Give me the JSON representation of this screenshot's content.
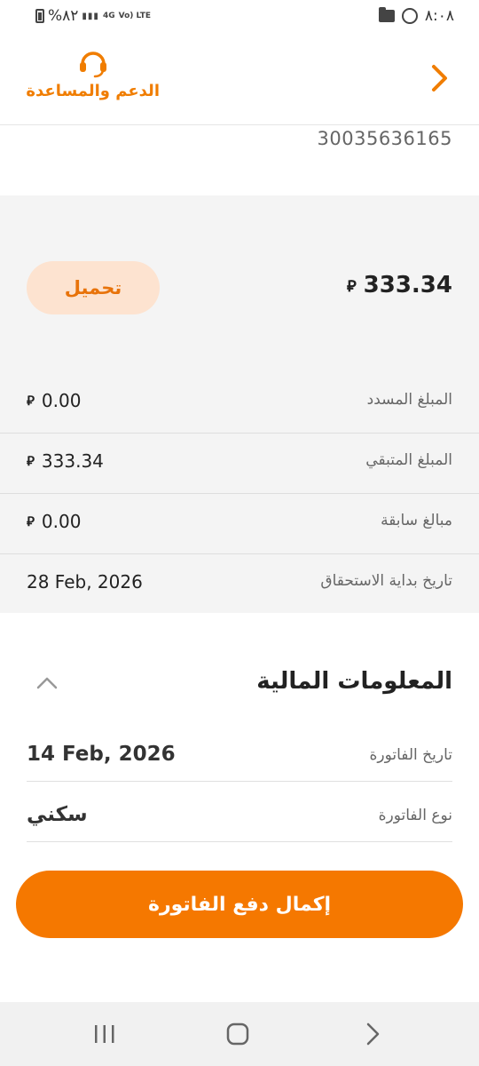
{
  "status_bar": {
    "battery_text": "%٨٢",
    "network_4g": "4G",
    "network_lte": "Vo) LTE",
    "time": "٨:٠٨"
  },
  "header": {
    "support_label": "الدعم والمساعدة",
    "back_icon": "chevron-right-icon"
  },
  "account_number": "30035636165",
  "summary": {
    "total_amount": "333.34",
    "currency_symbol": "⃁",
    "download_label": "تحميل",
    "rows": [
      {
        "label": "المبلغ المسدد",
        "value": "0.00"
      },
      {
        "label": "المبلغ المتبقي",
        "value": "333.34"
      },
      {
        "label": "مبالغ سابقة",
        "value": "0.00"
      },
      {
        "label": "تاريخ بداية الاستحقاق",
        "value": "28 Feb, 2026"
      }
    ]
  },
  "financial_info": {
    "title": "المعلومات المالية",
    "invoice_date_label": "تاريخ الفاتورة",
    "invoice_date_value": "14 Feb, 2026",
    "invoice_type_label": "نوع الفاتورة",
    "invoice_type_value": "سكني"
  },
  "pay_button_label": "إكمال دفع الفاتورة",
  "colors": {
    "accent": "#f57800",
    "download_bg": "#fde3d0",
    "panel_bg": "#f4f4f4"
  }
}
